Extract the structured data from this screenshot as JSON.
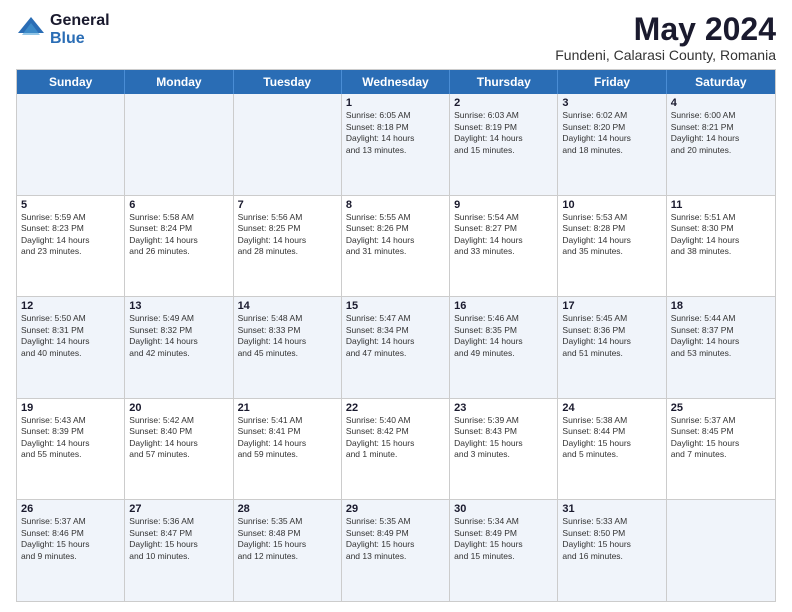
{
  "logo": {
    "general": "General",
    "blue": "Blue"
  },
  "title": "May 2024",
  "location": "Fundeni, Calarasi County, Romania",
  "days": [
    "Sunday",
    "Monday",
    "Tuesday",
    "Wednesday",
    "Thursday",
    "Friday",
    "Saturday"
  ],
  "rows": [
    [
      {
        "day": "",
        "lines": []
      },
      {
        "day": "",
        "lines": []
      },
      {
        "day": "",
        "lines": []
      },
      {
        "day": "1",
        "lines": [
          "Sunrise: 6:05 AM",
          "Sunset: 8:18 PM",
          "Daylight: 14 hours",
          "and 13 minutes."
        ]
      },
      {
        "day": "2",
        "lines": [
          "Sunrise: 6:03 AM",
          "Sunset: 8:19 PM",
          "Daylight: 14 hours",
          "and 15 minutes."
        ]
      },
      {
        "day": "3",
        "lines": [
          "Sunrise: 6:02 AM",
          "Sunset: 8:20 PM",
          "Daylight: 14 hours",
          "and 18 minutes."
        ]
      },
      {
        "day": "4",
        "lines": [
          "Sunrise: 6:00 AM",
          "Sunset: 8:21 PM",
          "Daylight: 14 hours",
          "and 20 minutes."
        ]
      }
    ],
    [
      {
        "day": "5",
        "lines": [
          "Sunrise: 5:59 AM",
          "Sunset: 8:23 PM",
          "Daylight: 14 hours",
          "and 23 minutes."
        ]
      },
      {
        "day": "6",
        "lines": [
          "Sunrise: 5:58 AM",
          "Sunset: 8:24 PM",
          "Daylight: 14 hours",
          "and 26 minutes."
        ]
      },
      {
        "day": "7",
        "lines": [
          "Sunrise: 5:56 AM",
          "Sunset: 8:25 PM",
          "Daylight: 14 hours",
          "and 28 minutes."
        ]
      },
      {
        "day": "8",
        "lines": [
          "Sunrise: 5:55 AM",
          "Sunset: 8:26 PM",
          "Daylight: 14 hours",
          "and 31 minutes."
        ]
      },
      {
        "day": "9",
        "lines": [
          "Sunrise: 5:54 AM",
          "Sunset: 8:27 PM",
          "Daylight: 14 hours",
          "and 33 minutes."
        ]
      },
      {
        "day": "10",
        "lines": [
          "Sunrise: 5:53 AM",
          "Sunset: 8:28 PM",
          "Daylight: 14 hours",
          "and 35 minutes."
        ]
      },
      {
        "day": "11",
        "lines": [
          "Sunrise: 5:51 AM",
          "Sunset: 8:30 PM",
          "Daylight: 14 hours",
          "and 38 minutes."
        ]
      }
    ],
    [
      {
        "day": "12",
        "lines": [
          "Sunrise: 5:50 AM",
          "Sunset: 8:31 PM",
          "Daylight: 14 hours",
          "and 40 minutes."
        ]
      },
      {
        "day": "13",
        "lines": [
          "Sunrise: 5:49 AM",
          "Sunset: 8:32 PM",
          "Daylight: 14 hours",
          "and 42 minutes."
        ]
      },
      {
        "day": "14",
        "lines": [
          "Sunrise: 5:48 AM",
          "Sunset: 8:33 PM",
          "Daylight: 14 hours",
          "and 45 minutes."
        ]
      },
      {
        "day": "15",
        "lines": [
          "Sunrise: 5:47 AM",
          "Sunset: 8:34 PM",
          "Daylight: 14 hours",
          "and 47 minutes."
        ]
      },
      {
        "day": "16",
        "lines": [
          "Sunrise: 5:46 AM",
          "Sunset: 8:35 PM",
          "Daylight: 14 hours",
          "and 49 minutes."
        ]
      },
      {
        "day": "17",
        "lines": [
          "Sunrise: 5:45 AM",
          "Sunset: 8:36 PM",
          "Daylight: 14 hours",
          "and 51 minutes."
        ]
      },
      {
        "day": "18",
        "lines": [
          "Sunrise: 5:44 AM",
          "Sunset: 8:37 PM",
          "Daylight: 14 hours",
          "and 53 minutes."
        ]
      }
    ],
    [
      {
        "day": "19",
        "lines": [
          "Sunrise: 5:43 AM",
          "Sunset: 8:39 PM",
          "Daylight: 14 hours",
          "and 55 minutes."
        ]
      },
      {
        "day": "20",
        "lines": [
          "Sunrise: 5:42 AM",
          "Sunset: 8:40 PM",
          "Daylight: 14 hours",
          "and 57 minutes."
        ]
      },
      {
        "day": "21",
        "lines": [
          "Sunrise: 5:41 AM",
          "Sunset: 8:41 PM",
          "Daylight: 14 hours",
          "and 59 minutes."
        ]
      },
      {
        "day": "22",
        "lines": [
          "Sunrise: 5:40 AM",
          "Sunset: 8:42 PM",
          "Daylight: 15 hours",
          "and 1 minute."
        ]
      },
      {
        "day": "23",
        "lines": [
          "Sunrise: 5:39 AM",
          "Sunset: 8:43 PM",
          "Daylight: 15 hours",
          "and 3 minutes."
        ]
      },
      {
        "day": "24",
        "lines": [
          "Sunrise: 5:38 AM",
          "Sunset: 8:44 PM",
          "Daylight: 15 hours",
          "and 5 minutes."
        ]
      },
      {
        "day": "25",
        "lines": [
          "Sunrise: 5:37 AM",
          "Sunset: 8:45 PM",
          "Daylight: 15 hours",
          "and 7 minutes."
        ]
      }
    ],
    [
      {
        "day": "26",
        "lines": [
          "Sunrise: 5:37 AM",
          "Sunset: 8:46 PM",
          "Daylight: 15 hours",
          "and 9 minutes."
        ]
      },
      {
        "day": "27",
        "lines": [
          "Sunrise: 5:36 AM",
          "Sunset: 8:47 PM",
          "Daylight: 15 hours",
          "and 10 minutes."
        ]
      },
      {
        "day": "28",
        "lines": [
          "Sunrise: 5:35 AM",
          "Sunset: 8:48 PM",
          "Daylight: 15 hours",
          "and 12 minutes."
        ]
      },
      {
        "day": "29",
        "lines": [
          "Sunrise: 5:35 AM",
          "Sunset: 8:49 PM",
          "Daylight: 15 hours",
          "and 13 minutes."
        ]
      },
      {
        "day": "30",
        "lines": [
          "Sunrise: 5:34 AM",
          "Sunset: 8:49 PM",
          "Daylight: 15 hours",
          "and 15 minutes."
        ]
      },
      {
        "day": "31",
        "lines": [
          "Sunrise: 5:33 AM",
          "Sunset: 8:50 PM",
          "Daylight: 15 hours",
          "and 16 minutes."
        ]
      },
      {
        "day": "",
        "lines": []
      }
    ]
  ],
  "alt_rows": [
    0,
    2,
    4
  ]
}
